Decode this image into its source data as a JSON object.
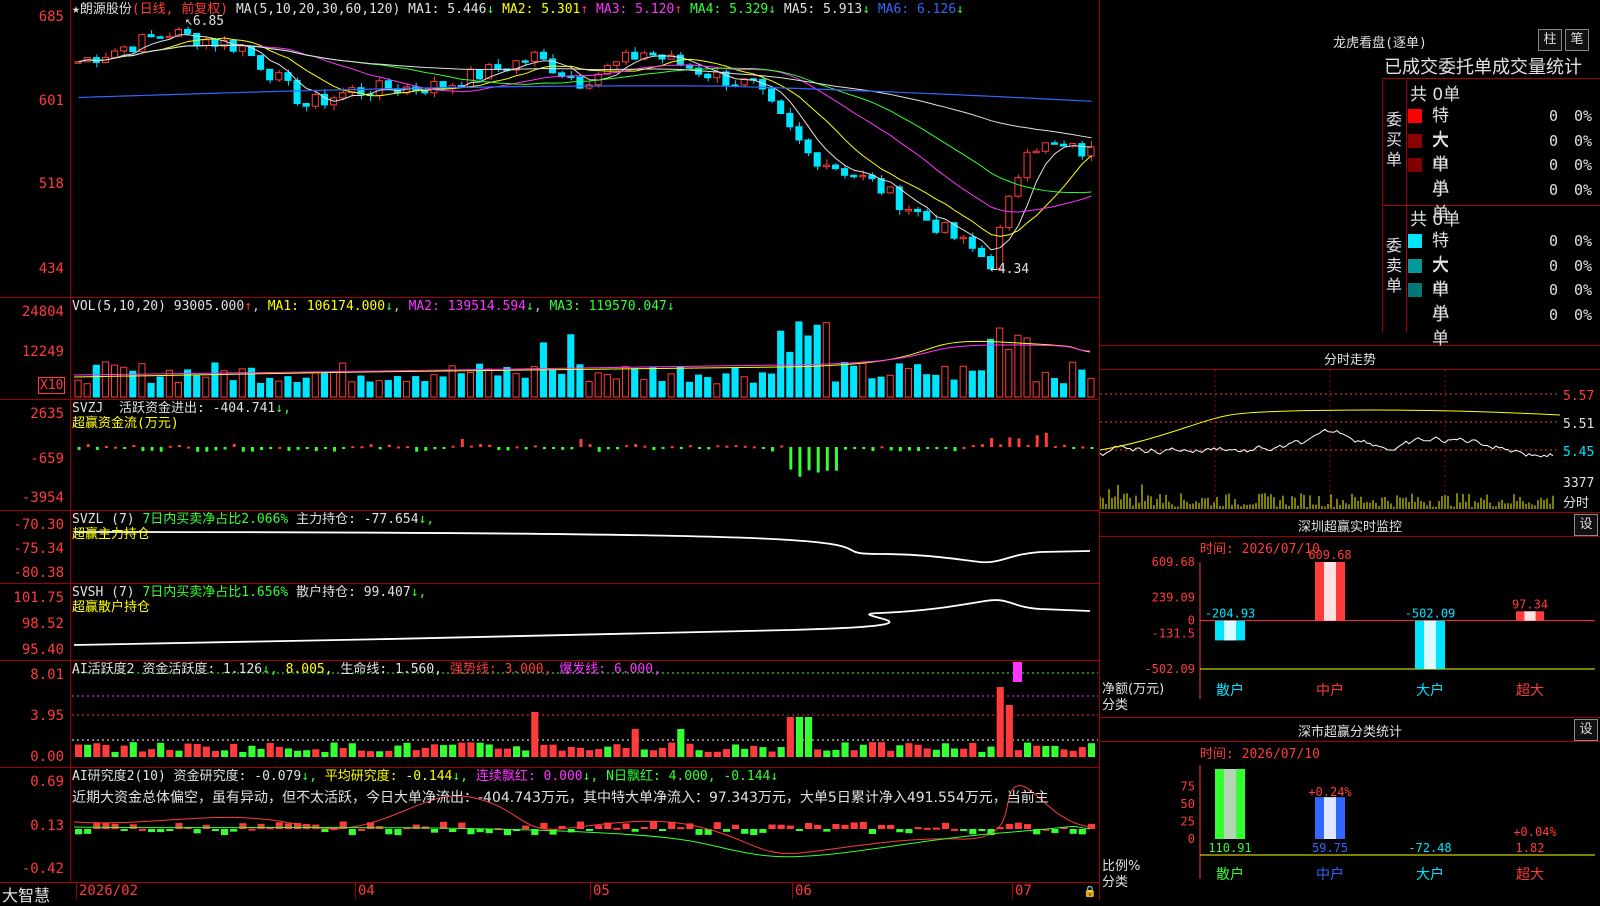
{
  "app": {
    "brand": "大智慧"
  },
  "kline": {
    "title": "★朗源股份",
    "period": "(日线, 前复权)",
    "ma_prefix": "MA(5,10,20,30,60,120)",
    "ma": [
      {
        "label": "MA1:",
        "value": "5.446",
        "arrow": "↓",
        "color": "#e0e0e0"
      },
      {
        "label": "MA2:",
        "value": "5.301",
        "arrow": "↑",
        "color": "#ffff00"
      },
      {
        "label": "MA3:",
        "value": "5.120",
        "arrow": "↑",
        "color": "#ff33ff"
      },
      {
        "label": "MA4:",
        "value": "5.329",
        "arrow": "↓",
        "color": "#33ff33"
      },
      {
        "label": "MA5:",
        "value": "5.913",
        "arrow": "↓",
        "color": "#e0e0e0"
      },
      {
        "label": "MA6:",
        "value": "6.126",
        "arrow": "↓",
        "color": "#3366ff"
      }
    ],
    "yticks": [
      "685",
      "601",
      "518",
      "434"
    ],
    "high_label": "6.85",
    "low_label": "←4.34"
  },
  "vol": {
    "label": "VOL(5,10,20)",
    "value": "93005.000",
    "v_arrow": "↑",
    "ma1": "MA1: 106174.000",
    "ma1_arrow": "↓",
    "ma2": "MA2: 139514.594",
    "ma2_arrow": "↓",
    "ma3": "MA3: 119570.047",
    "ma3_arrow": "↓",
    "yticks": [
      "24804",
      "12249"
    ],
    "unit": "X10"
  },
  "svzj": {
    "label": "SVZJ",
    "desc": "活跃资金进出:",
    "value": "-404.741",
    "arrow": "↓,",
    "sub": "超赢资金流(万元)",
    "yticks": [
      "2635",
      "-659",
      "-3954"
    ]
  },
  "svzl": {
    "label": "SVZL (7)",
    "desc": "7日内买卖净占比2.066%",
    "desc2": "主力持仓:",
    "value": "-77.654",
    "arrow": "↓,",
    "sub": "超赢主力持仓",
    "yticks": [
      "-70.30",
      "-75.34",
      "-80.38"
    ]
  },
  "svsh": {
    "label": "SVSH (7)",
    "desc": "7日内买卖净占比1.656%",
    "desc2": "散户持仓:",
    "value": "99.407",
    "arrow": "↓,",
    "sub": "超赢散户持仓",
    "yticks": [
      "101.75",
      "98.52",
      "95.40"
    ]
  },
  "aihy": {
    "label": "AI活跃度2",
    "p1": "资金活跃度: 1.126",
    "p1a": "↓,",
    "p2": "8.005,",
    "p3": "生命线: 1.560,",
    "p4": "强势线: 3.000,",
    "p5": "爆发线: 6.000,",
    "yticks": [
      "8.01",
      "3.95",
      "0.00"
    ]
  },
  "aiyj": {
    "label": "AI研究度2(10)",
    "p1": "资金研究度: -0.079",
    "p1a": "↓,",
    "p2": "平均研究度: -0.144",
    "p2a": "↓,",
    "p3": "连续飘红: 0.000",
    "p3a": "↓,",
    "p4": "N日飘红: 4.000, -0.144",
    "p4a": "↓",
    "comment": "近期大资金总体偏空，虽有异动，但不太活跃，今日大单净流出：-404.743万元，其中特大单净流入：97.343万元，大单5日累计净入491.554万元，当前主",
    "yticks": [
      "0.69",
      "0.13",
      "-0.42"
    ]
  },
  "xaxis": {
    "labels": [
      "2026/02",
      "04",
      "05",
      "06",
      "07"
    ]
  },
  "lhb": {
    "title": "龙虎看盘(逐单)",
    "btn1": "柱",
    "btn2": "笔",
    "header": "已成交委托单成交量统计",
    "buy": {
      "side": "委买单",
      "total": "共 0单",
      "rows": [
        {
          "label": "特大",
          "n": "0",
          "p": "0%",
          "color": "#ff0000"
        },
        {
          "label": "大单",
          "n": "0",
          "p": "0%",
          "color": "#8b0000"
        },
        {
          "label": "中单",
          "n": "0",
          "p": "0%",
          "color": "#800000"
        },
        {
          "label": "小单",
          "n": "0",
          "p": "0%",
          "color": "#000000"
        }
      ]
    },
    "sell": {
      "side": "委卖单",
      "total": "共 0单",
      "rows": [
        {
          "label": "特大",
          "n": "0",
          "p": "0%",
          "color": "#00e5ff"
        },
        {
          "label": "大单",
          "n": "0",
          "p": "0%",
          "color": "#009999"
        },
        {
          "label": "中单",
          "n": "0",
          "p": "0%",
          "color": "#007777"
        },
        {
          "label": "小单",
          "n": "0",
          "p": "0%",
          "color": "#000000"
        }
      ]
    }
  },
  "fenshi": {
    "title": "分时走势",
    "yticks": [
      "5.57",
      "5.51",
      "5.45"
    ],
    "vol_label": "3377",
    "vol_unit": "分时"
  },
  "szcy": {
    "title": "深圳超赢实时监控",
    "gear": "设",
    "time": "时间: 2026/07/10",
    "yticks": [
      "609.68",
      "239.09",
      "0",
      "-131.5",
      "-502.09"
    ],
    "ylabel": "净额(万元)",
    "xlabel": "分类"
  },
  "szfl": {
    "title": "深市超赢分类统计",
    "gear": "设",
    "time": "时间: 2026/07/10",
    "yticks": [
      "75",
      "50",
      "25",
      "0"
    ],
    "ylabel": "比例%",
    "xlabel": "分类"
  },
  "chart_data": [
    {
      "type": "bar",
      "title": "深圳超赢实时监控",
      "categories": [
        "散户",
        "中户",
        "大户",
        "超大"
      ],
      "values": [
        -204.93,
        609.68,
        -502.09,
        97.34
      ],
      "ylabel": "净额(万元)",
      "xlabel": "分类",
      "ylim": [
        -502.09,
        609.68
      ],
      "colors": [
        "#00e5ff",
        "#ff3b3b",
        "#00e5ff",
        "#ff3b3b"
      ]
    },
    {
      "type": "bar",
      "title": "深市超赢分类统计",
      "categories": [
        "散户",
        "中户",
        "大户",
        "超大"
      ],
      "values": [
        110.91,
        59.75,
        -72.48,
        1.82
      ],
      "pct": [
        "",
        "+0.24%",
        "",
        "+0.04%"
      ],
      "ylabel": "比例%",
      "xlabel": "分类",
      "colors": [
        "#33ff33",
        "#3366ff",
        "#00e5ff",
        "#ff3b3b"
      ]
    }
  ]
}
